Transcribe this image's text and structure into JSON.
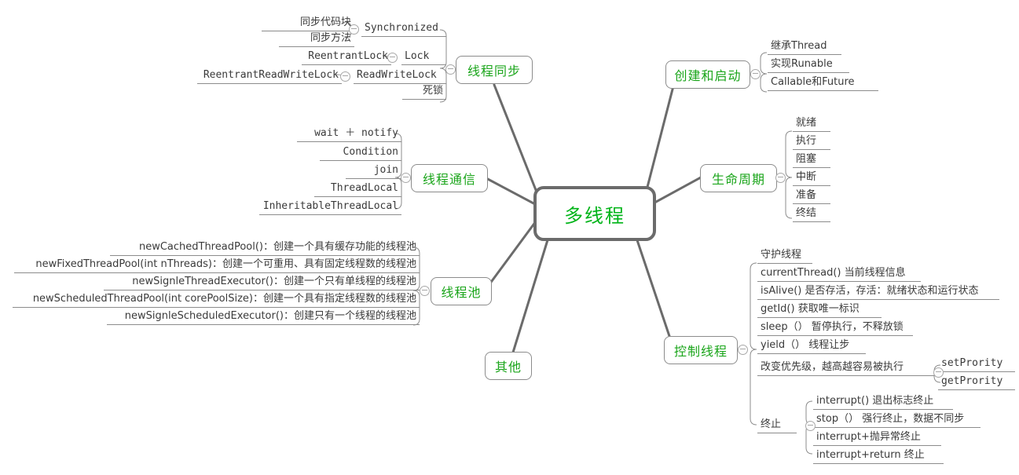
{
  "diagram": {
    "type": "mindmap",
    "root": {
      "label": "多线程"
    },
    "accent_color": "#00b418",
    "branch_text_color": "#1aa51a",
    "line_color": "#6b6b6b",
    "leaf_text_color": "#3a3a3a",
    "icons": {
      "collapse": "minus-circle-icon"
    }
  },
  "branches": {
    "thread_sync": {
      "label": "线程同步",
      "children": [
        {
          "label": "Synchronized",
          "children": [
            {
              "label": "同步代码块"
            },
            {
              "label": "同步方法"
            }
          ]
        },
        {
          "label": "Lock",
          "children": [
            {
              "label": "ReentrantLock"
            }
          ]
        },
        {
          "label": "ReadWriteLock",
          "children": [
            {
              "label": "ReentrantReadWriteLock"
            }
          ]
        },
        {
          "label": "死锁"
        }
      ]
    },
    "thread_comm": {
      "label": "线程通信",
      "children": [
        {
          "label": "wait ＋ notify"
        },
        {
          "label": "Condition"
        },
        {
          "label": "join"
        },
        {
          "label": "ThreadLocal"
        },
        {
          "label": "InheritableThreadLocal"
        }
      ]
    },
    "thread_pool": {
      "label": "线程池",
      "children": [
        {
          "label": "newCachedThreadPool()：创建一个具有缓存功能的线程池"
        },
        {
          "label": "newFixedThreadPool(int nThreads)：创建一个可重用、具有固定线程数的线程池"
        },
        {
          "label": "newSignleThreadExecutor()：创建一个只有单线程的线程池"
        },
        {
          "label": "newScheduledThreadPool(int corePoolSize)：创建一个具有指定线程数的线程池"
        },
        {
          "label": "newSignleScheduledExecutor()：创建只有一个线程的线程池"
        }
      ]
    },
    "others": {
      "label": "其他",
      "children": []
    },
    "create_start": {
      "label": "创建和启动",
      "children": [
        {
          "label": "继承Thread"
        },
        {
          "label": "实现Runable"
        },
        {
          "label": "Callable和Future"
        }
      ]
    },
    "lifecycle": {
      "label": "生命周期",
      "children": [
        {
          "label": "就绪"
        },
        {
          "label": "执行"
        },
        {
          "label": "阻塞"
        },
        {
          "label": "中断"
        },
        {
          "label": "准备"
        },
        {
          "label": "终结"
        }
      ]
    },
    "control_thread": {
      "label": "控制线程",
      "children": [
        {
          "label": "守护线程"
        },
        {
          "label": "currentThread()  当前线程信息"
        },
        {
          "label": "isAlive()  是否存活，存活：就绪状态和运行状态"
        },
        {
          "label": "getId()  获取唯一标识"
        },
        {
          "label": "sleep（）  暂停执行，不释放锁"
        },
        {
          "label": "yield（）  线程让步"
        },
        {
          "label": "改变优先级，越高越容易被执行",
          "children": [
            {
              "label": "setPrority"
            },
            {
              "label": "getPrority"
            }
          ]
        },
        {
          "label": "终止",
          "children": [
            {
              "label": "interrupt() 退出标志终止"
            },
            {
              "label": "stop（）  强行终止，数据不同步"
            },
            {
              "label": "interrupt+抛异常终止"
            },
            {
              "label": "interrupt+return 终止"
            }
          ]
        }
      ]
    }
  }
}
